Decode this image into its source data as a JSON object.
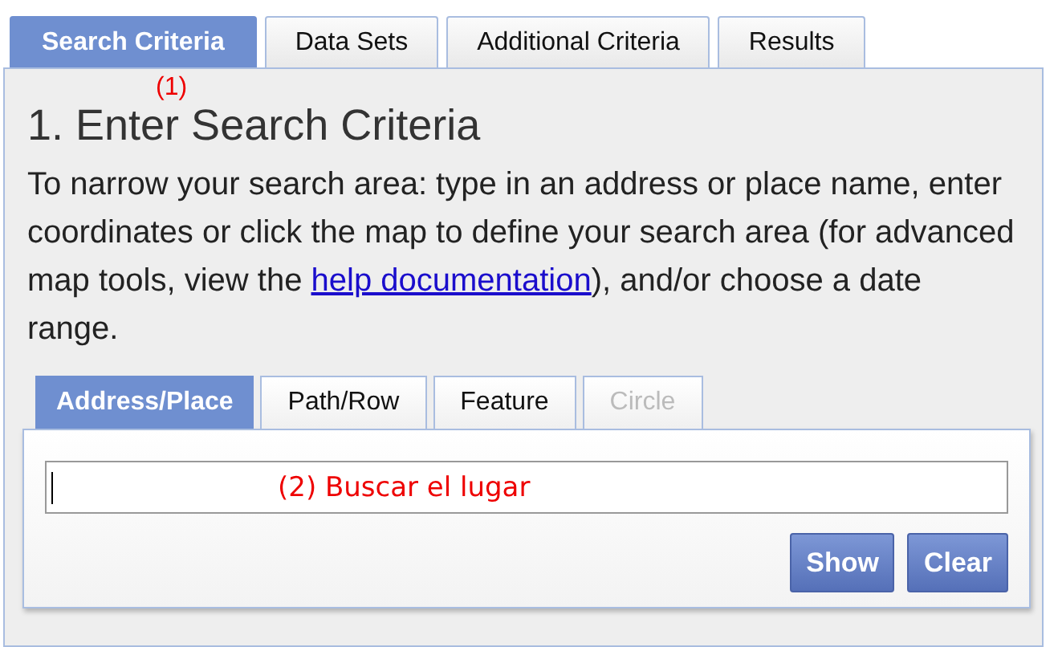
{
  "tabs": [
    {
      "label": "Search Criteria",
      "selected": true
    },
    {
      "label": "Data Sets",
      "selected": false
    },
    {
      "label": "Additional Criteria",
      "selected": false
    },
    {
      "label": "Results",
      "selected": false
    }
  ],
  "annotation_1": "(1)",
  "heading": "1. Enter Search Criteria",
  "intro": {
    "before": "To narrow your search area: type in an address or place name, enter coordinates or click the map to define your search area (for advanced map tools, view the",
    "link": "help documentation",
    "after": "), and/or choose a date range."
  },
  "sub_tabs": [
    {
      "label": "Address/Place",
      "selected": true,
      "disabled": false
    },
    {
      "label": "Path/Row",
      "selected": false,
      "disabled": false
    },
    {
      "label": "Feature",
      "selected": false,
      "disabled": false
    },
    {
      "label": "Circle",
      "selected": false,
      "disabled": true
    }
  ],
  "address_field": {
    "annotation": "(2) Buscar el lugar"
  },
  "buttons": [
    "Show",
    "Clear"
  ]
}
